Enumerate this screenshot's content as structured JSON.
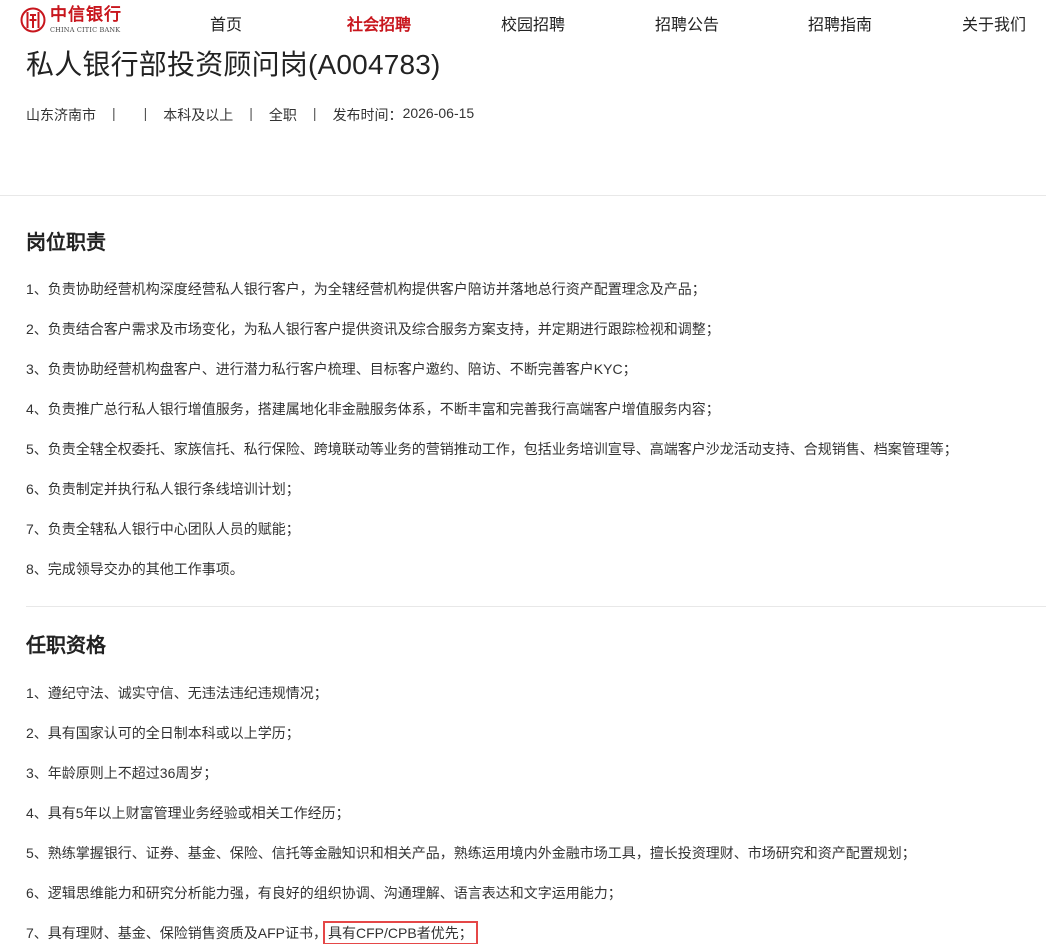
{
  "brand": {
    "name_cn": "中信银行",
    "name_en": "CHINA CITIC BANK",
    "color": "#c8161d"
  },
  "nav": [
    {
      "label": "首页",
      "active": false
    },
    {
      "label": "社会招聘",
      "active": true
    },
    {
      "label": "校园招聘",
      "active": false
    },
    {
      "label": "招聘公告",
      "active": false
    },
    {
      "label": "招聘指南",
      "active": false
    },
    {
      "label": "关于我们",
      "active": false
    }
  ],
  "job": {
    "title": "私人银行部投资顾问岗(A004783)",
    "meta": {
      "location": "山东济南市",
      "field_empty": "",
      "education": "本科及以上",
      "type": "全职",
      "publish_label": "发布时间：",
      "publish_date": "2026-06-15",
      "separator": "|"
    }
  },
  "sections": {
    "duties": {
      "title": "岗位职责",
      "items": [
        "1、负责协助经营机构深度经营私人银行客户，为全辖经营机构提供客户陪访并落地总行资产配置理念及产品；",
        "2、负责结合客户需求及市场变化，为私人银行客户提供资讯及综合服务方案支持，并定期进行跟踪检视和调整；",
        "3、负责协助经营机构盘客户、进行潜力私行客户梳理、目标客户邀约、陪访、不断完善客户KYC；",
        "4、负责推广总行私人银行增值服务，搭建属地化非金融服务体系，不断丰富和完善我行高端客户增值服务内容；",
        "5、负责全辖全权委托、家族信托、私行保险、跨境联动等业务的营销推动工作，包括业务培训宣导、高端客户沙龙活动支持、合规销售、档案管理等；",
        "6、负责制定并执行私人银行条线培训计划；",
        "7、负责全辖私人银行中心团队人员的赋能；",
        "8、完成领导交办的其他工作事项。"
      ]
    },
    "qualifications": {
      "title": "任职资格",
      "items": [
        "1、遵纪守法、诚实守信、无违法违纪违规情况；",
        "2、具有国家认可的全日制本科或以上学历；",
        "3、年龄原则上不超过36周岁；",
        "4、具有5年以上财富管理业务经验或相关工作经历；",
        "5、熟练掌握银行、证券、基金、保险、信托等金融知识和相关产品，熟练运用境内外金融市场工具，擅长投资理财、市场研究和资产配置规划；",
        "6、逻辑思维能力和研究分析能力强，有良好的组织协调、沟通理解、语言表达和文字运用能力；"
      ],
      "last_item": {
        "prefix": "7、具有理财、基金、保险销售资质及AFP证书，",
        "highlighted": "具有CFP/CPB者优先；"
      }
    }
  },
  "highlight_color": "#e54747"
}
